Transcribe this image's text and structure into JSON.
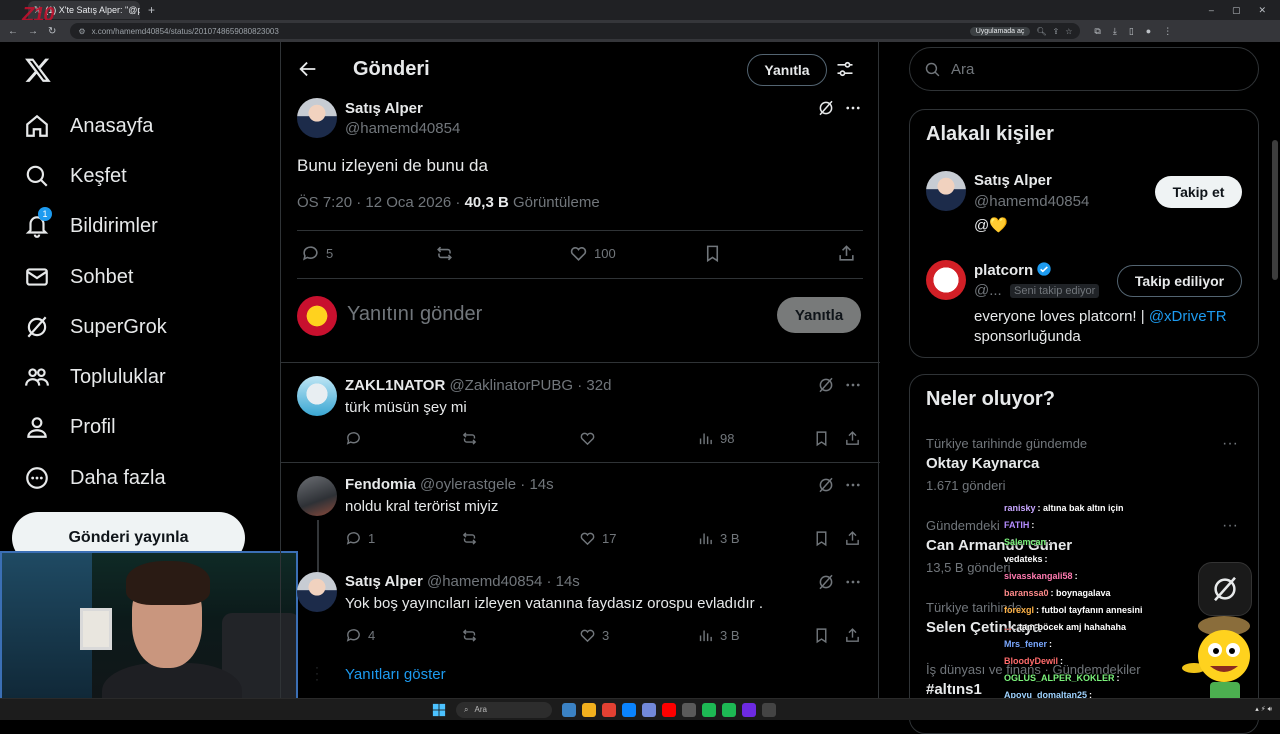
{
  "browser": {
    "tab_title": "(1) X'te Satış Alper: \"@platcorn\"",
    "url": "x.com/hamemd40854/status/2010748659080823003",
    "open_in_app": "Uygulamada aç",
    "overlay_logo": "Z10"
  },
  "nav": {
    "items": [
      {
        "label": "Anasayfa",
        "icon": "home-icon"
      },
      {
        "label": "Keşfet",
        "icon": "search-icon"
      },
      {
        "label": "Bildirimler",
        "icon": "bell-icon",
        "badge": "1"
      },
      {
        "label": "Sohbet",
        "icon": "mail-icon"
      },
      {
        "label": "SuperGrok",
        "icon": "grok-icon"
      },
      {
        "label": "Topluluklar",
        "icon": "communities-icon"
      },
      {
        "label": "Profil",
        "icon": "profile-icon"
      },
      {
        "label": "Daha fazla",
        "icon": "more-circle-icon"
      }
    ],
    "post_button": "Gönderi yayınla"
  },
  "header": {
    "title": "Gönderi",
    "reply_button": "Yanıtla"
  },
  "main_post": {
    "name": "Satış Alper",
    "handle": "@hamemd40854",
    "text": "Bunu izleyeni de bunu da",
    "time": "ÖS 7:20 · 12 Oca 2026 · ",
    "views": "40,3 B",
    "views_label": " Görüntüleme",
    "replies": "5",
    "likes": "100"
  },
  "compose": {
    "placeholder": "Yanıtını gönder",
    "button": "Yanıtla"
  },
  "replies": [
    {
      "name": "ZAKL1NATOR",
      "handle": "@ZaklinatorPUBG · 32d",
      "text": "türk müsün şey mi",
      "replies": "",
      "likes": "",
      "views": "98"
    },
    {
      "name": "Fendomia",
      "handle": "@oylerastgele · 14s",
      "text": "noldu kral terörist miyiz",
      "replies": "1",
      "likes": "17",
      "views": "3 B"
    },
    {
      "name": "Satış Alper",
      "handle": "@hamemd40854 · 14s",
      "text": "Yok boş yayıncıları izleyen vatanına faydasız orospu evladıdır .",
      "replies": "4",
      "likes": "3",
      "views": "3 B"
    }
  ],
  "show_replies": "Yanıtları göster",
  "search": {
    "placeholder": "Ara"
  },
  "relevant": {
    "title": "Alakalı kişiler",
    "people": [
      {
        "name": "Satış Alper",
        "handle": "@hamemd40854",
        "bio": "@💛",
        "button": "Takip et"
      },
      {
        "name": "platcorn",
        "handle": "@...",
        "follows_you": "Seni takip ediyor",
        "bio_text": "everyone loves platcorn! | ",
        "bio_link": "@xDriveTR",
        "bio_suffix": "sponsorluğunda",
        "button": "Takip ediliyor"
      }
    ]
  },
  "trends": {
    "title": "Neler oluyor?",
    "items": [
      {
        "context": "Türkiye tarihinde gündemde",
        "name": "Oktay Kaynarca",
        "count": "1.671 gönderi"
      },
      {
        "context": "Gündemdeki",
        "name": "Can Armando Güner",
        "count": "13,5 B gönderi"
      },
      {
        "context": "Türkiye tarihinde",
        "name": "Selen Çetinkaya",
        "count": ""
      },
      {
        "context": "İş dünyası ve finans · Gündemdekiler",
        "name": "#altıns1",
        "count": ""
      }
    ]
  },
  "chat": [
    {
      "user": "ranisky",
      "msg": ": altına bak altın için",
      "color": "#c7a6ff"
    },
    {
      "user": "FATIH",
      "msg": ":",
      "color": "#b48cff"
    },
    {
      "user": "Salemcan",
      "msg": ":",
      "color": "#7bf27b"
    },
    {
      "user": "vedateks",
      "msg": ":",
      "color": "#ffffff"
    },
    {
      "user": "sivasskangali58",
      "msg": ":",
      "color": "#ff7ab0"
    },
    {
      "user": "baranssa0",
      "msg": ": boynagalava",
      "color": "#ff8a8a"
    },
    {
      "user": "forexgl",
      "msg": ": futbol tayfanın annesini",
      "color": "#ffb347"
    },
    {
      "user": "...",
      "msg": ": tam böcek amj hahahaha",
      "color": "#ff5c5c"
    },
    {
      "user": "Mrs_fener",
      "msg": ":",
      "color": "#7aa8ff"
    },
    {
      "user": "BloodyDewil",
      "msg": ":",
      "color": "#ff6b6b"
    },
    {
      "user": "OGLUS_ALPER_KOKLER",
      "msg": ":",
      "color": "#7bf27b"
    },
    {
      "user": "Apoyu_domaltan25",
      "msg": ":",
      "color": "#9fd3ff"
    },
    {
      "user": "vedateks",
      "msg": ":",
      "color": "#ffffff"
    }
  ],
  "taskbar": {
    "search": "Ara"
  },
  "colors": {
    "accent": "#1d9bf0",
    "border": "#2f3336",
    "muted": "#71767b"
  }
}
